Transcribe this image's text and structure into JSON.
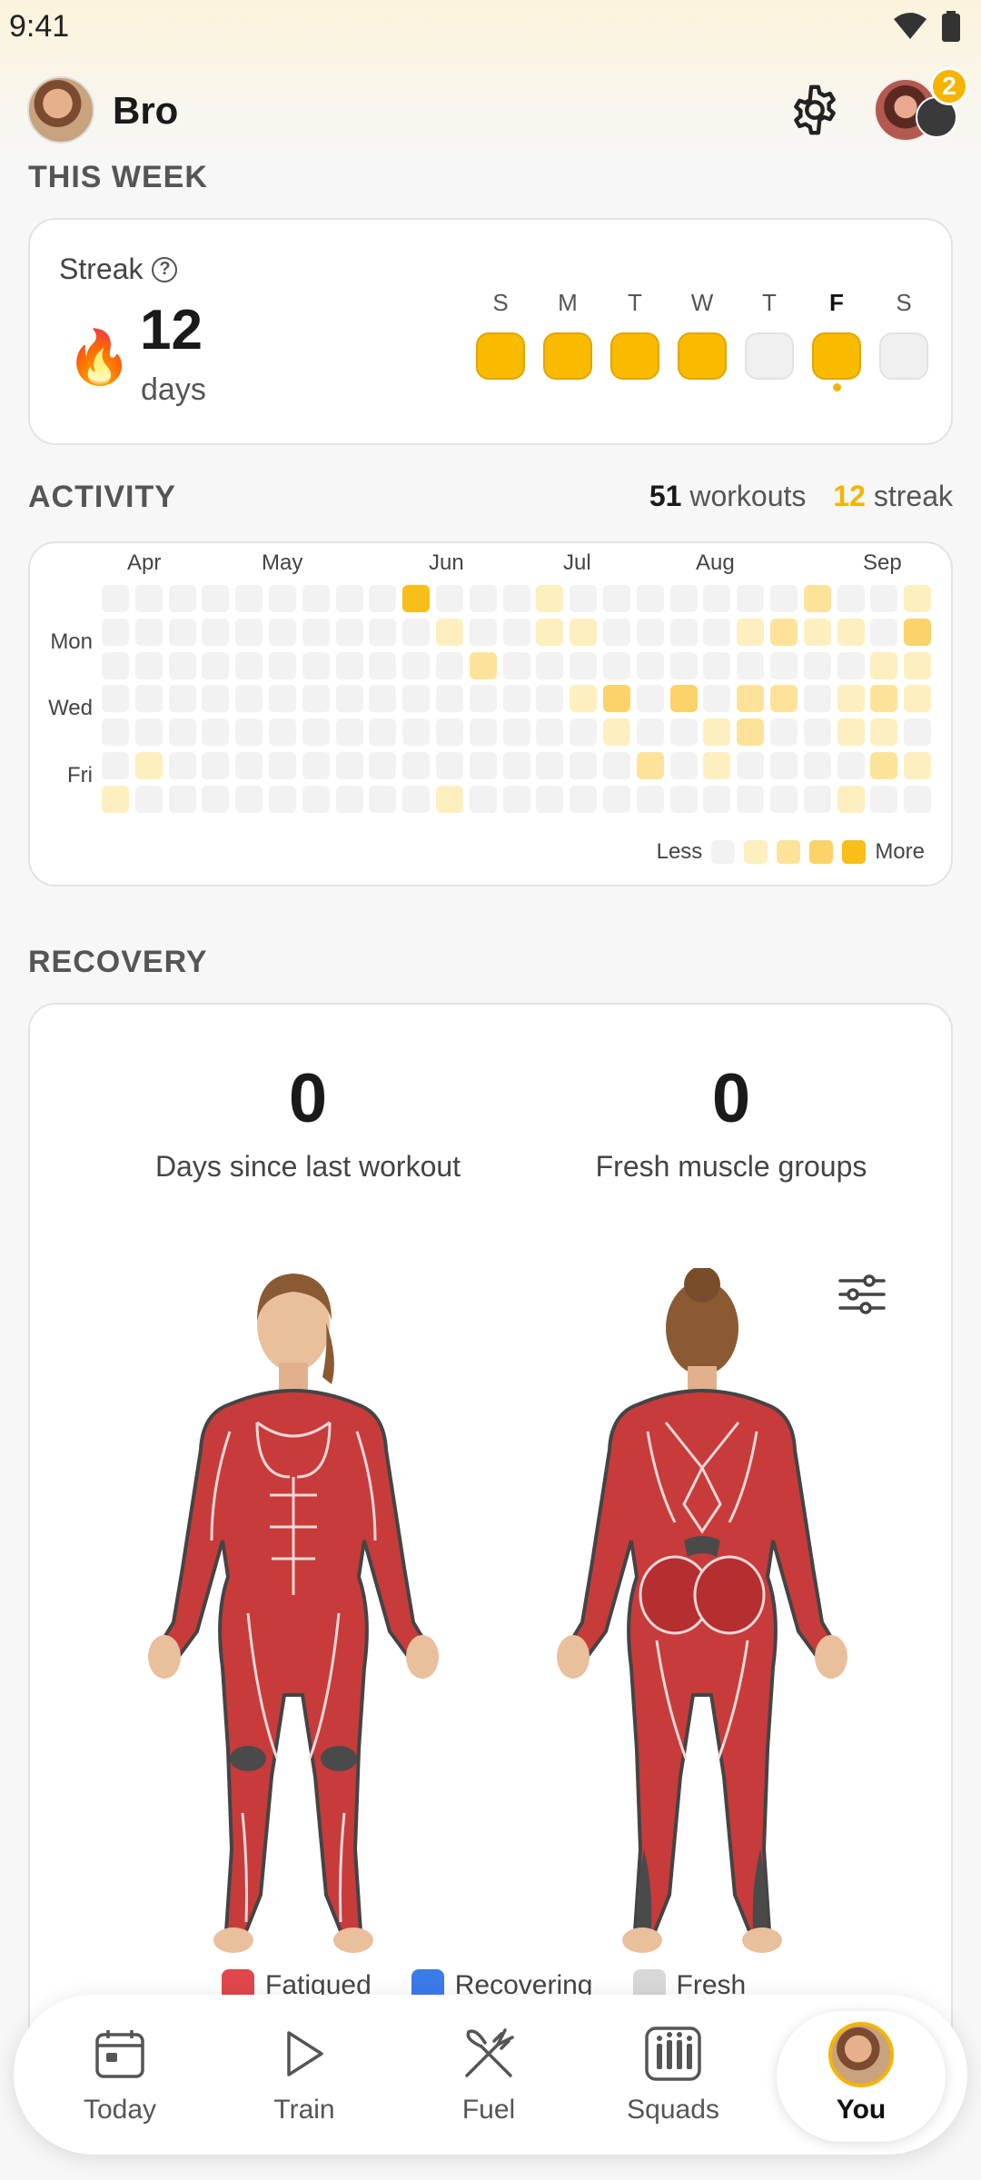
{
  "status": {
    "time": "9:41"
  },
  "header": {
    "user_name": "Bro",
    "notification_count": "2"
  },
  "this_week": {
    "section_title": "THIS WEEK",
    "streak_label": "Streak",
    "help_glyph": "?",
    "flame_glyph": "🔥",
    "streak_value": "12",
    "streak_unit": "days",
    "days": [
      {
        "letter": "S",
        "done": true,
        "today": false
      },
      {
        "letter": "M",
        "done": true,
        "today": false
      },
      {
        "letter": "T",
        "done": true,
        "today": false
      },
      {
        "letter": "W",
        "done": true,
        "today": false
      },
      {
        "letter": "T",
        "done": false,
        "today": false
      },
      {
        "letter": "F",
        "done": true,
        "today": true
      },
      {
        "letter": "S",
        "done": false,
        "today": false
      }
    ]
  },
  "activity": {
    "section_title": "ACTIVITY",
    "workouts_count": "51",
    "workouts_label": "workouts",
    "streak_count": "12",
    "streak_label": "streak",
    "months": [
      "Apr",
      "May",
      "Jun",
      "Jul",
      "Aug",
      "Sep"
    ],
    "row_labels": [
      "Mon",
      "Wed",
      "Fri"
    ],
    "legend_less": "Less",
    "legend_more": "More",
    "levels": [
      "#f2f2f2",
      "#fdefc0",
      "#fde39a",
      "#fbd36a",
      "#f8be19"
    ],
    "grid": [
      [
        0,
        0,
        0,
        0,
        0,
        0,
        0,
        0,
        0,
        4,
        0,
        0,
        0,
        1,
        0,
        0,
        0,
        0,
        0,
        0,
        0,
        2,
        0,
        0,
        1
      ],
      [
        0,
        0,
        0,
        0,
        0,
        0,
        0,
        0,
        0,
        0,
        1,
        0,
        0,
        1,
        1,
        0,
        0,
        0,
        0,
        1,
        2,
        1,
        1,
        0,
        3
      ],
      [
        0,
        0,
        0,
        0,
        0,
        0,
        0,
        0,
        0,
        0,
        0,
        2,
        0,
        0,
        0,
        0,
        0,
        0,
        0,
        0,
        0,
        0,
        0,
        1,
        1
      ],
      [
        0,
        0,
        0,
        0,
        0,
        0,
        0,
        0,
        0,
        0,
        0,
        0,
        0,
        0,
        1,
        3,
        0,
        3,
        0,
        2,
        2,
        0,
        1,
        2,
        1
      ],
      [
        0,
        0,
        0,
        0,
        0,
        0,
        0,
        0,
        0,
        0,
        0,
        0,
        0,
        0,
        0,
        1,
        0,
        0,
        1,
        2,
        0,
        0,
        1,
        1,
        0
      ],
      [
        0,
        1,
        0,
        0,
        0,
        0,
        0,
        0,
        0,
        0,
        0,
        0,
        0,
        0,
        0,
        0,
        2,
        0,
        1,
        0,
        0,
        0,
        0,
        2,
        1
      ],
      [
        1,
        0,
        0,
        0,
        0,
        0,
        0,
        0,
        0,
        0,
        1,
        0,
        0,
        0,
        0,
        0,
        0,
        0,
        0,
        0,
        0,
        0,
        1,
        0,
        0
      ]
    ]
  },
  "recovery": {
    "section_title": "RECOVERY",
    "days_since_value": "0",
    "days_since_label": "Days since last workout",
    "fresh_value": "0",
    "fresh_label": "Fresh muscle groups",
    "legend": [
      {
        "label": "Fatigued",
        "color": "#e0474c"
      },
      {
        "label": "Recovering",
        "color": "#3b7be8"
      },
      {
        "label": "Fresh",
        "color": "#d8d8d8"
      }
    ]
  },
  "nav": {
    "items": [
      {
        "label": "Today",
        "icon": "calendar-icon"
      },
      {
        "label": "Train",
        "icon": "play-icon"
      },
      {
        "label": "Fuel",
        "icon": "utensils-icon"
      },
      {
        "label": "Squads",
        "icon": "squads-icon"
      }
    ],
    "active_label": "You"
  },
  "colors": {
    "accent": "#f5b400",
    "muscle": "#c73b3b"
  }
}
